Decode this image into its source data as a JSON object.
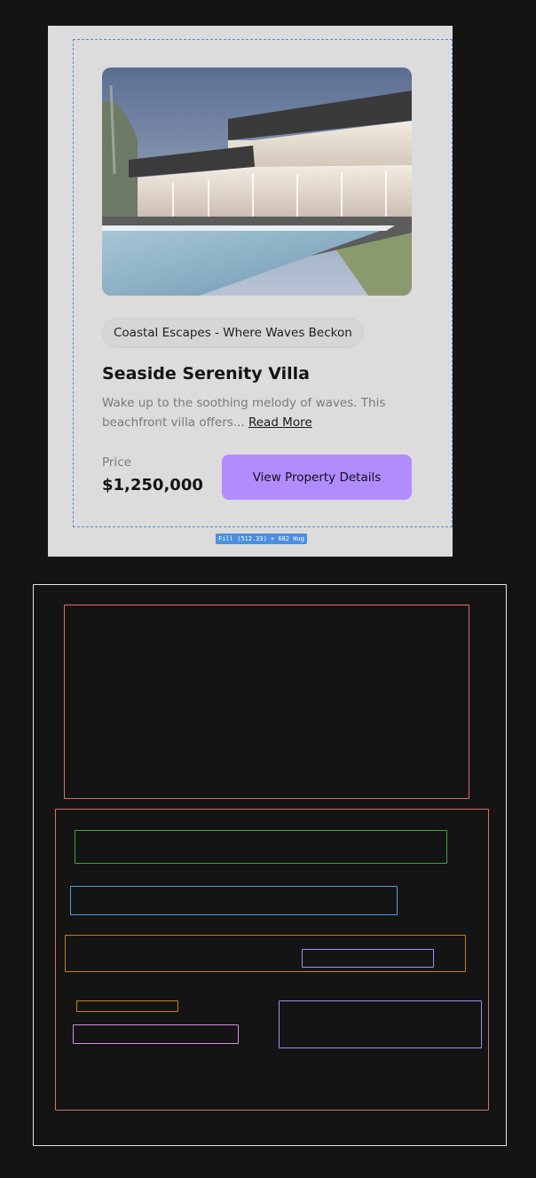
{
  "card": {
    "tag": "Coastal Escapes - Where Waves Beckon",
    "title": "Seaside Serenity Villa",
    "description": "Wake up to the soothing melody of waves. This beachfront villa offers...",
    "read_more": "Read More",
    "price_label": "Price",
    "price_value": "$1,250,000",
    "cta_label": "View Property Details"
  },
  "editor": {
    "dimension_badge": "Fill (512.33) × 682 Hug"
  },
  "colors": {
    "canvas_bg": "#141414",
    "card_bg": "#dcdcdc",
    "accent": "#b18cff",
    "selection": "#4a90d9"
  }
}
